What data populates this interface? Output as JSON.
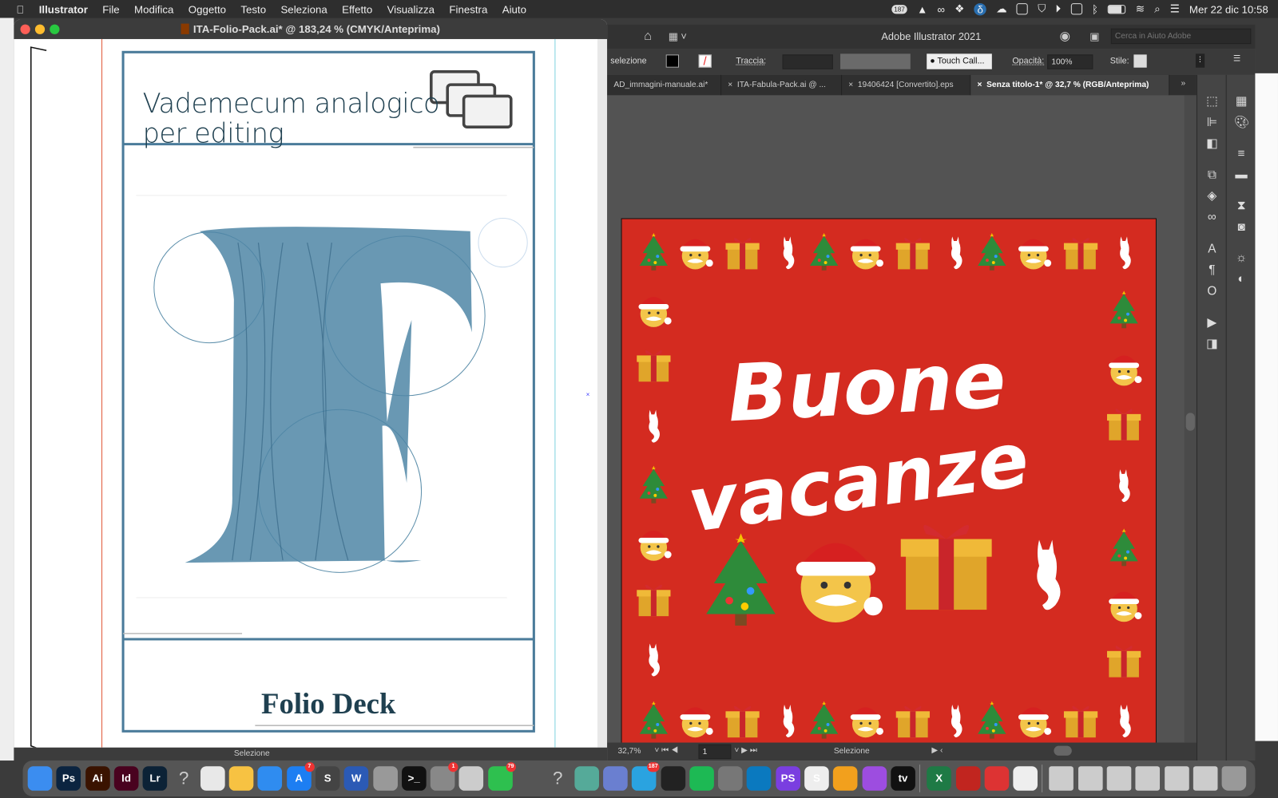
{
  "menubar": {
    "app": "Illustrator",
    "items": [
      "File",
      "Modifica",
      "Oggetto",
      "Testo",
      "Seleziona",
      "Effetto",
      "Visualizza",
      "Finestra",
      "Aiuto"
    ],
    "status_badge": "187",
    "datetime": "Mer 22 dic  10:58"
  },
  "left_window": {
    "title": "ITA-Folio-Pack.ai* @ 183,24 % (CMYK/Anteprima)",
    "status_tool": "Selezione",
    "document": {
      "title_line1": "Vademecum analogico",
      "title_line2": "per editing",
      "footer": "Folio Deck"
    },
    "frame_color": "#4a7b9a",
    "text_color": "#1f4050"
  },
  "right_window": {
    "title": "Adobe Illustrator 2021",
    "search_placeholder": "Cerca in Aiuto Adobe",
    "control": {
      "selection_label": "selezione",
      "stroke_label": "Traccia:",
      "brush": "Touch Call...",
      "opacity_label": "Opacità:",
      "opacity_value": "100%",
      "style_label": "Stile:"
    },
    "tabs": [
      {
        "label": "AD_immagini-manuale.ai*",
        "active": false
      },
      {
        "label": "ITA-Fabula-Pack.ai @ ...",
        "active": false
      },
      {
        "label": "19406424 [Convertito].eps",
        "active": false
      },
      {
        "label": "Senza titolo-1* @ 32,7 % (RGB/Anteprima)",
        "active": true
      }
    ],
    "status": {
      "zoom": "32,7%",
      "artboard": "1",
      "tool": "Selezione"
    },
    "card": {
      "background": "#d42b20",
      "line1": "Buone",
      "line2": "vacanze",
      "border_pattern": [
        "tree-icon",
        "santa-icon",
        "gift-icon",
        "cat-icon"
      ]
    }
  },
  "dock": {
    "apps": [
      {
        "name": "Finder",
        "label": "",
        "color": "#3b8df0"
      },
      {
        "name": "Photoshop",
        "label": "Ps",
        "color": "#0b2440"
      },
      {
        "name": "Illustrator",
        "label": "Ai",
        "color": "#3a1300"
      },
      {
        "name": "InDesign",
        "label": "Id",
        "color": "#49021f"
      },
      {
        "name": "Lightroom",
        "label": "Lr",
        "color": "#0c2236"
      },
      {
        "name": "Unknown",
        "label": "?",
        "color": "transparent"
      },
      {
        "name": "Chrome",
        "label": "",
        "color": "#e8e8e8"
      },
      {
        "name": "Sketch",
        "label": "",
        "color": "#f7c242"
      },
      {
        "name": "Keynote",
        "label": "",
        "color": "#2f8cf0"
      },
      {
        "name": "App Store",
        "label": "A",
        "color": "#1d7ef2",
        "badge": "7"
      },
      {
        "name": "Sublime",
        "label": "S",
        "color": "#444"
      },
      {
        "name": "Word",
        "label": "W",
        "color": "#2b5ab5"
      },
      {
        "name": "Preview",
        "label": "",
        "color": "#999"
      },
      {
        "name": "Terminal",
        "label": ">_",
        "color": "#111"
      },
      {
        "name": "System Preferences",
        "label": "",
        "color": "#888",
        "badge": "1"
      },
      {
        "name": "Time Machine",
        "label": "",
        "color": "#ccc"
      },
      {
        "name": "WhatsApp",
        "label": "",
        "color": "#2ec04f",
        "badge": "79"
      },
      {
        "name": "VLC",
        "label": "",
        "color": "transparent"
      },
      {
        "name": "Unknown 2",
        "label": "?",
        "color": "transparent"
      },
      {
        "name": "Atom",
        "label": "",
        "color": "#5a9"
      },
      {
        "name": "Archive",
        "label": "",
        "color": "#6a7fd0"
      },
      {
        "name": "Telegram",
        "label": "",
        "color": "#2aa3e0",
        "badge": "187"
      },
      {
        "name": "Activity Monitor",
        "label": "",
        "color": "#222"
      },
      {
        "name": "Spotify",
        "label": "",
        "color": "#1db954"
      },
      {
        "name": "Calculator",
        "label": "",
        "color": "#777"
      },
      {
        "name": "Trello",
        "label": "",
        "color": "#0a79bf"
      },
      {
        "name": "PhpStorm",
        "label": "PS",
        "color": "#7a3ee0"
      },
      {
        "name": "Scrivener",
        "label": "S",
        "color": "#eee"
      },
      {
        "name": "TablePlus",
        "label": "",
        "color": "#f2a01d"
      },
      {
        "name": "Podcasts",
        "label": "",
        "color": "#9d4de0"
      },
      {
        "name": "Apple TV",
        "label": "tv",
        "color": "#111"
      },
      {
        "name": "Excel",
        "label": "X",
        "color": "#1e7a45"
      },
      {
        "name": "Acrobat",
        "label": "",
        "color": "#c1251f"
      },
      {
        "name": "Unknown App",
        "label": "",
        "color": "#d33"
      },
      {
        "name": "TextEdit",
        "label": "",
        "color": "#eee"
      }
    ],
    "docs": [
      "Recent 1",
      "Recent 2",
      "Recent 3",
      "Recent 4",
      "Recent 5",
      "Recent 6",
      "Trash"
    ]
  }
}
